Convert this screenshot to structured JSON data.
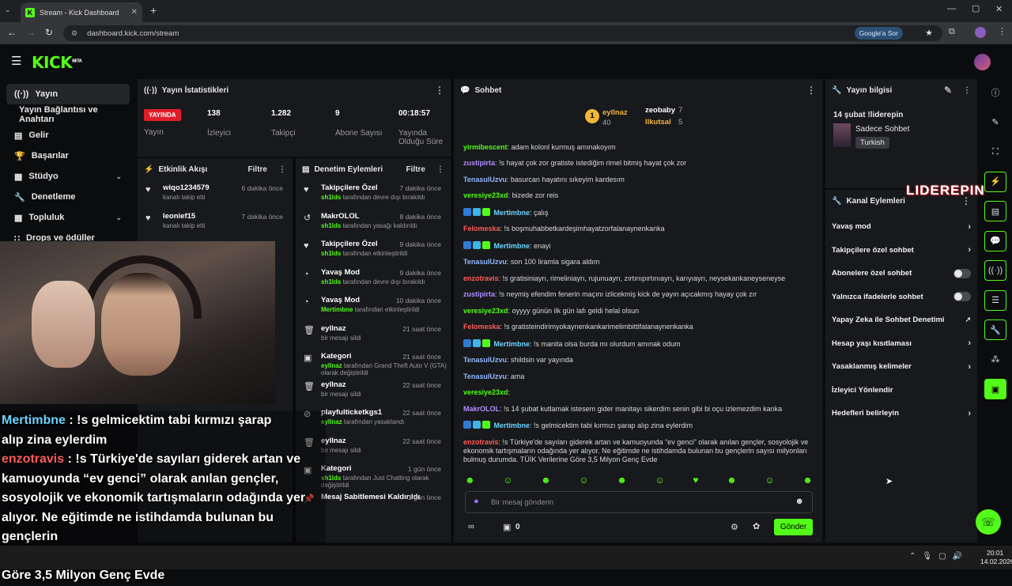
{
  "browser": {
    "tab_title": "Stream - Kick Dashboard",
    "url": "dashboard.kick.com/stream",
    "google_btn": "Google'a Sor"
  },
  "app": {
    "logo": "KICK",
    "beta": "BETA"
  },
  "nav": {
    "items": [
      {
        "label": "Yayın"
      },
      {
        "label": "Yayın Bağlantısı ve Anahtarı"
      },
      {
        "label": "Gelir"
      },
      {
        "label": "Başarılar"
      },
      {
        "label": "Stüdyo"
      },
      {
        "label": "Denetleme"
      },
      {
        "label": "Topluluk"
      },
      {
        "label": "Drops ve ödüller"
      }
    ]
  },
  "stats": {
    "title": "Yayın İstatistikleri",
    "live_badge": "YAYINDA",
    "live_label": "Yayın",
    "viewers": "138",
    "viewers_label": "İzleyici",
    "followers": "1.282",
    "followers_label": "Takipçi",
    "subs": "9",
    "subs_label": "Abone Sayısı",
    "uptime": "00:18:57",
    "uptime_label1": "Yayında",
    "uptime_label2": "Olduğu Süre"
  },
  "activity": {
    "title": "Etkinlik Akışı",
    "filter": "Filtre",
    "items": [
      {
        "name": "wiqo1234579",
        "sub": "kanalı takip etti",
        "ago": "6 dakika önce"
      },
      {
        "name": "leonief15",
        "sub": "kanalı takip etti",
        "ago": "7 dakika önce"
      }
    ]
  },
  "mod": {
    "title": "Denetim Eylemleri",
    "filter": "Filtre",
    "items": [
      {
        "icon": "♥",
        "name": "Takipçilere Özel",
        "who": "sh1lds",
        "sub": " tarafından devre dışı bırakıldı",
        "ago": "7 dakika önce"
      },
      {
        "icon": "↺",
        "name": "MakrOLOL",
        "who": "sh1lds",
        "sub": " tarafından yasağı kaldırıldı",
        "ago": "8 dakika önce"
      },
      {
        "icon": "♥",
        "name": "Takipçilere Özel",
        "who": "sh1lds",
        "sub": " tarafından etkinleştirildi",
        "ago": "9 dakika önce"
      },
      {
        "icon": "◔",
        "name": "Yavaş Mod",
        "who": "sh1lds",
        "sub": " tarafından devre dışı bırakıldı",
        "ago": "9 dakika önce"
      },
      {
        "icon": "◔",
        "name": "Yavaş Mod",
        "who": "Mertimbne",
        "sub": " tarafından etkinleştirildi",
        "ago": "10 dakika önce"
      },
      {
        "icon": "🗑",
        "name": "eyllnaz",
        "who": "",
        "sub": "bir mesajı sildi",
        "ago": "21 saat önce"
      },
      {
        "icon": "▣",
        "name": "Kategori",
        "who": "eyllnaz",
        "sub": " tarafından Grand Theft Auto V (GTA) olarak değiştirildi",
        "ago": "21 saat önce"
      },
      {
        "icon": "🗑",
        "name": "eyllnaz",
        "who": "",
        "sub": "bir mesajı sildi",
        "ago": "22 saat önce"
      },
      {
        "icon": "⊘",
        "name": "playfulticketkgs1",
        "who": "eyllnaz",
        "sub": " tarafından yasaklandı",
        "ago": "22 saat önce"
      },
      {
        "icon": "🗑",
        "name": "eyllnaz",
        "who": "",
        "sub": "bir mesajı sildi",
        "ago": "22 saat önce"
      },
      {
        "icon": "▣",
        "name": "Kategori",
        "who": "sh1lds",
        "sub": " tarafından Just Chatting olarak değiştirildi",
        "ago": "1 gün önce"
      },
      {
        "icon": "📌",
        "name": "Mesaj Sabitlemesi Kaldırıldı",
        "who": "",
        "sub": "",
        "ago": "1 gün önce"
      }
    ]
  },
  "chat": {
    "title": "Sohbet",
    "top": [
      {
        "rank": "1",
        "name": "eyllnaz",
        "count": "40"
      },
      {
        "name": "zeobaby",
        "count": "7"
      },
      {
        "name": "llkutsal",
        "count": "5"
      }
    ],
    "messages": [
      {
        "user": "yirmibescent",
        "color": "#53fc18",
        "text": ": adam kolonl kurmuş amınakoyım"
      },
      {
        "user": "zustipirta",
        "color": "#b18cff",
        "text": ": !s hayat çok zor gratiste istediğim rimel bitmiş hayat çok zor"
      },
      {
        "user": "TenasulUzvu",
        "color": "#8fb7ff",
        "text": ": basurcan hayatını sıkeyim kardesım"
      },
      {
        "user": "veresiye23xd",
        "color": "#53fc18",
        "text": ": bizede zor reis"
      },
      {
        "user": "Mertimbne",
        "color": "#6dd3ff",
        "badges": true,
        "text": ": çalış"
      },
      {
        "user": "Felomeska",
        "color": "#ff5c5c",
        "text": ": !s boşmuhabbetkardeşimhayatzorfalanaynenkanka"
      },
      {
        "user": "Mertimbne",
        "color": "#6dd3ff",
        "badges": true,
        "text": ": enayi"
      },
      {
        "user": "TenasulUzvu",
        "color": "#8fb7ff",
        "text": ": son 100 liramla sigara aldım"
      },
      {
        "user": "enzotravis",
        "color": "#ff5c5c",
        "text": ": !s gratisiniayrı, rimeliniayrı, rujunuayrı, zırtınıpırtınıayrı, karıyıayrı, neysekankaneyseneyse"
      },
      {
        "user": "zustipirta",
        "color": "#b18cff",
        "text": ": !s neymiş efendim fenerin maçını izlicekmiş kick de yayın açıcakmış hayay çok zır"
      },
      {
        "user": "veresiye23xd",
        "color": "#53fc18",
        "text": ": oyyyy günün ilk gün lafı geldi helal olsun"
      },
      {
        "user": "Felomeska",
        "color": "#ff5c5c",
        "text": ": !s gratisteindirimyokaynenkankarimelimbittifalanaynenkanka"
      },
      {
        "user": "Mertimbne",
        "color": "#6dd3ff",
        "badges": true,
        "text": ": !s manita olsa burda mı olurdum amınak odum"
      },
      {
        "user": "TenasulUzvu",
        "color": "#8fb7ff",
        "text": ": shildsin var yayında"
      },
      {
        "user": "TenasulUzvu",
        "color": "#8fb7ff",
        "text": ": ama"
      },
      {
        "user": "veresiye23xd",
        "color": "#53fc18",
        "text": ":"
      },
      {
        "user": "MakrOLOL",
        "color": "#b18cff",
        "text": ": !s 14 şubat kutlamak istesem gider manitayı sikerdim senin gibi bi oçu izlemezdim kanka"
      },
      {
        "user": "Mertimbne",
        "color": "#6dd3ff",
        "badges": true,
        "text": ": !s gelmicektim tabi kırmızı şarap alıp zina eylerdim"
      },
      {
        "user": "enzotravis",
        "color": "#ff5c5c",
        "text": ": !s Türkiye'de sayıları giderek artan ve kamuoyunda “ev genci” olarak anılan gençler, sosyolojik ve ekonomik tartışmaların odağında yer alıyor. Ne eğitimde ne istihdamda bulunan bu gençlerin sayısı milyonları bulmuş durumda. TÜİK Verilerine Göre 3,5 Milyon Genç Evde"
      }
    ],
    "input_placeholder": "Bir mesaj gönderin",
    "points": "0",
    "send": "Gönder"
  },
  "info": {
    "title": "Yayın bilgisi",
    "stream_title": "14 şubat !liderepin",
    "category": "Sadece Sohbet",
    "language": "Turkish"
  },
  "channel": {
    "title": "Kanal Eylemleri",
    "items": [
      {
        "label": "Yavaş mod",
        "kind": "chev"
      },
      {
        "label": "Takipçilere özel sohbet",
        "kind": "chev"
      },
      {
        "label": "Abonelere özel sohbet",
        "kind": "toggle"
      },
      {
        "label": "Yalnızca ifadelerle sohbet",
        "kind": "toggle"
      },
      {
        "label": "Yapay Zeka ile Sohbet Denetimi",
        "kind": "ext"
      },
      {
        "label": "Hesap yaşı kısıtlaması",
        "kind": "chev"
      },
      {
        "label": "Yasaklanmış kelimeler",
        "kind": "chev"
      },
      {
        "label": "İzleyici Yönlendir",
        "kind": "none"
      },
      {
        "label": "Hedefleri belirleyin",
        "kind": "chev"
      }
    ]
  },
  "watermark": "LIDEREPIN",
  "overlay": {
    "lines": [
      {
        "user": "Mertimbne",
        "ucolor": "#6dd3ff",
        "text": " : !s gelmicektim tabi kırmızı şarap"
      },
      {
        "user": "",
        "ucolor": "",
        "text": "alıp zina eylerdim"
      },
      {
        "user": "enzotravis",
        "ucolor": "#ff5c5c",
        "text": " : !s Türkiye'de sayıları giderek artan ve"
      },
      {
        "user": "",
        "ucolor": "",
        "text": "kamuoyunda “ev genci” olarak anılan gençler,"
      },
      {
        "user": "",
        "ucolor": "",
        "text": "sosyolojik ve ekonomik tartışmaların odağında yer"
      },
      {
        "user": "",
        "ucolor": "",
        "text": "alıyor. Ne eğitimde ne istihdamda bulunan bu gençlerin"
      },
      {
        "user": "",
        "ucolor": "",
        "text": "sayısı milyonları bulmuş durumda. TÜİK Verilerine"
      },
      {
        "user": "",
        "ucolor": "",
        "text": "Göre 3,5 Milyon Genç Evde"
      }
    ]
  },
  "taskbar": {
    "time": "20:01",
    "date": "14.02.2026"
  },
  "colors": {
    "accent": "#53fc18",
    "live": "#e01e2a",
    "panel": "#18191c"
  }
}
